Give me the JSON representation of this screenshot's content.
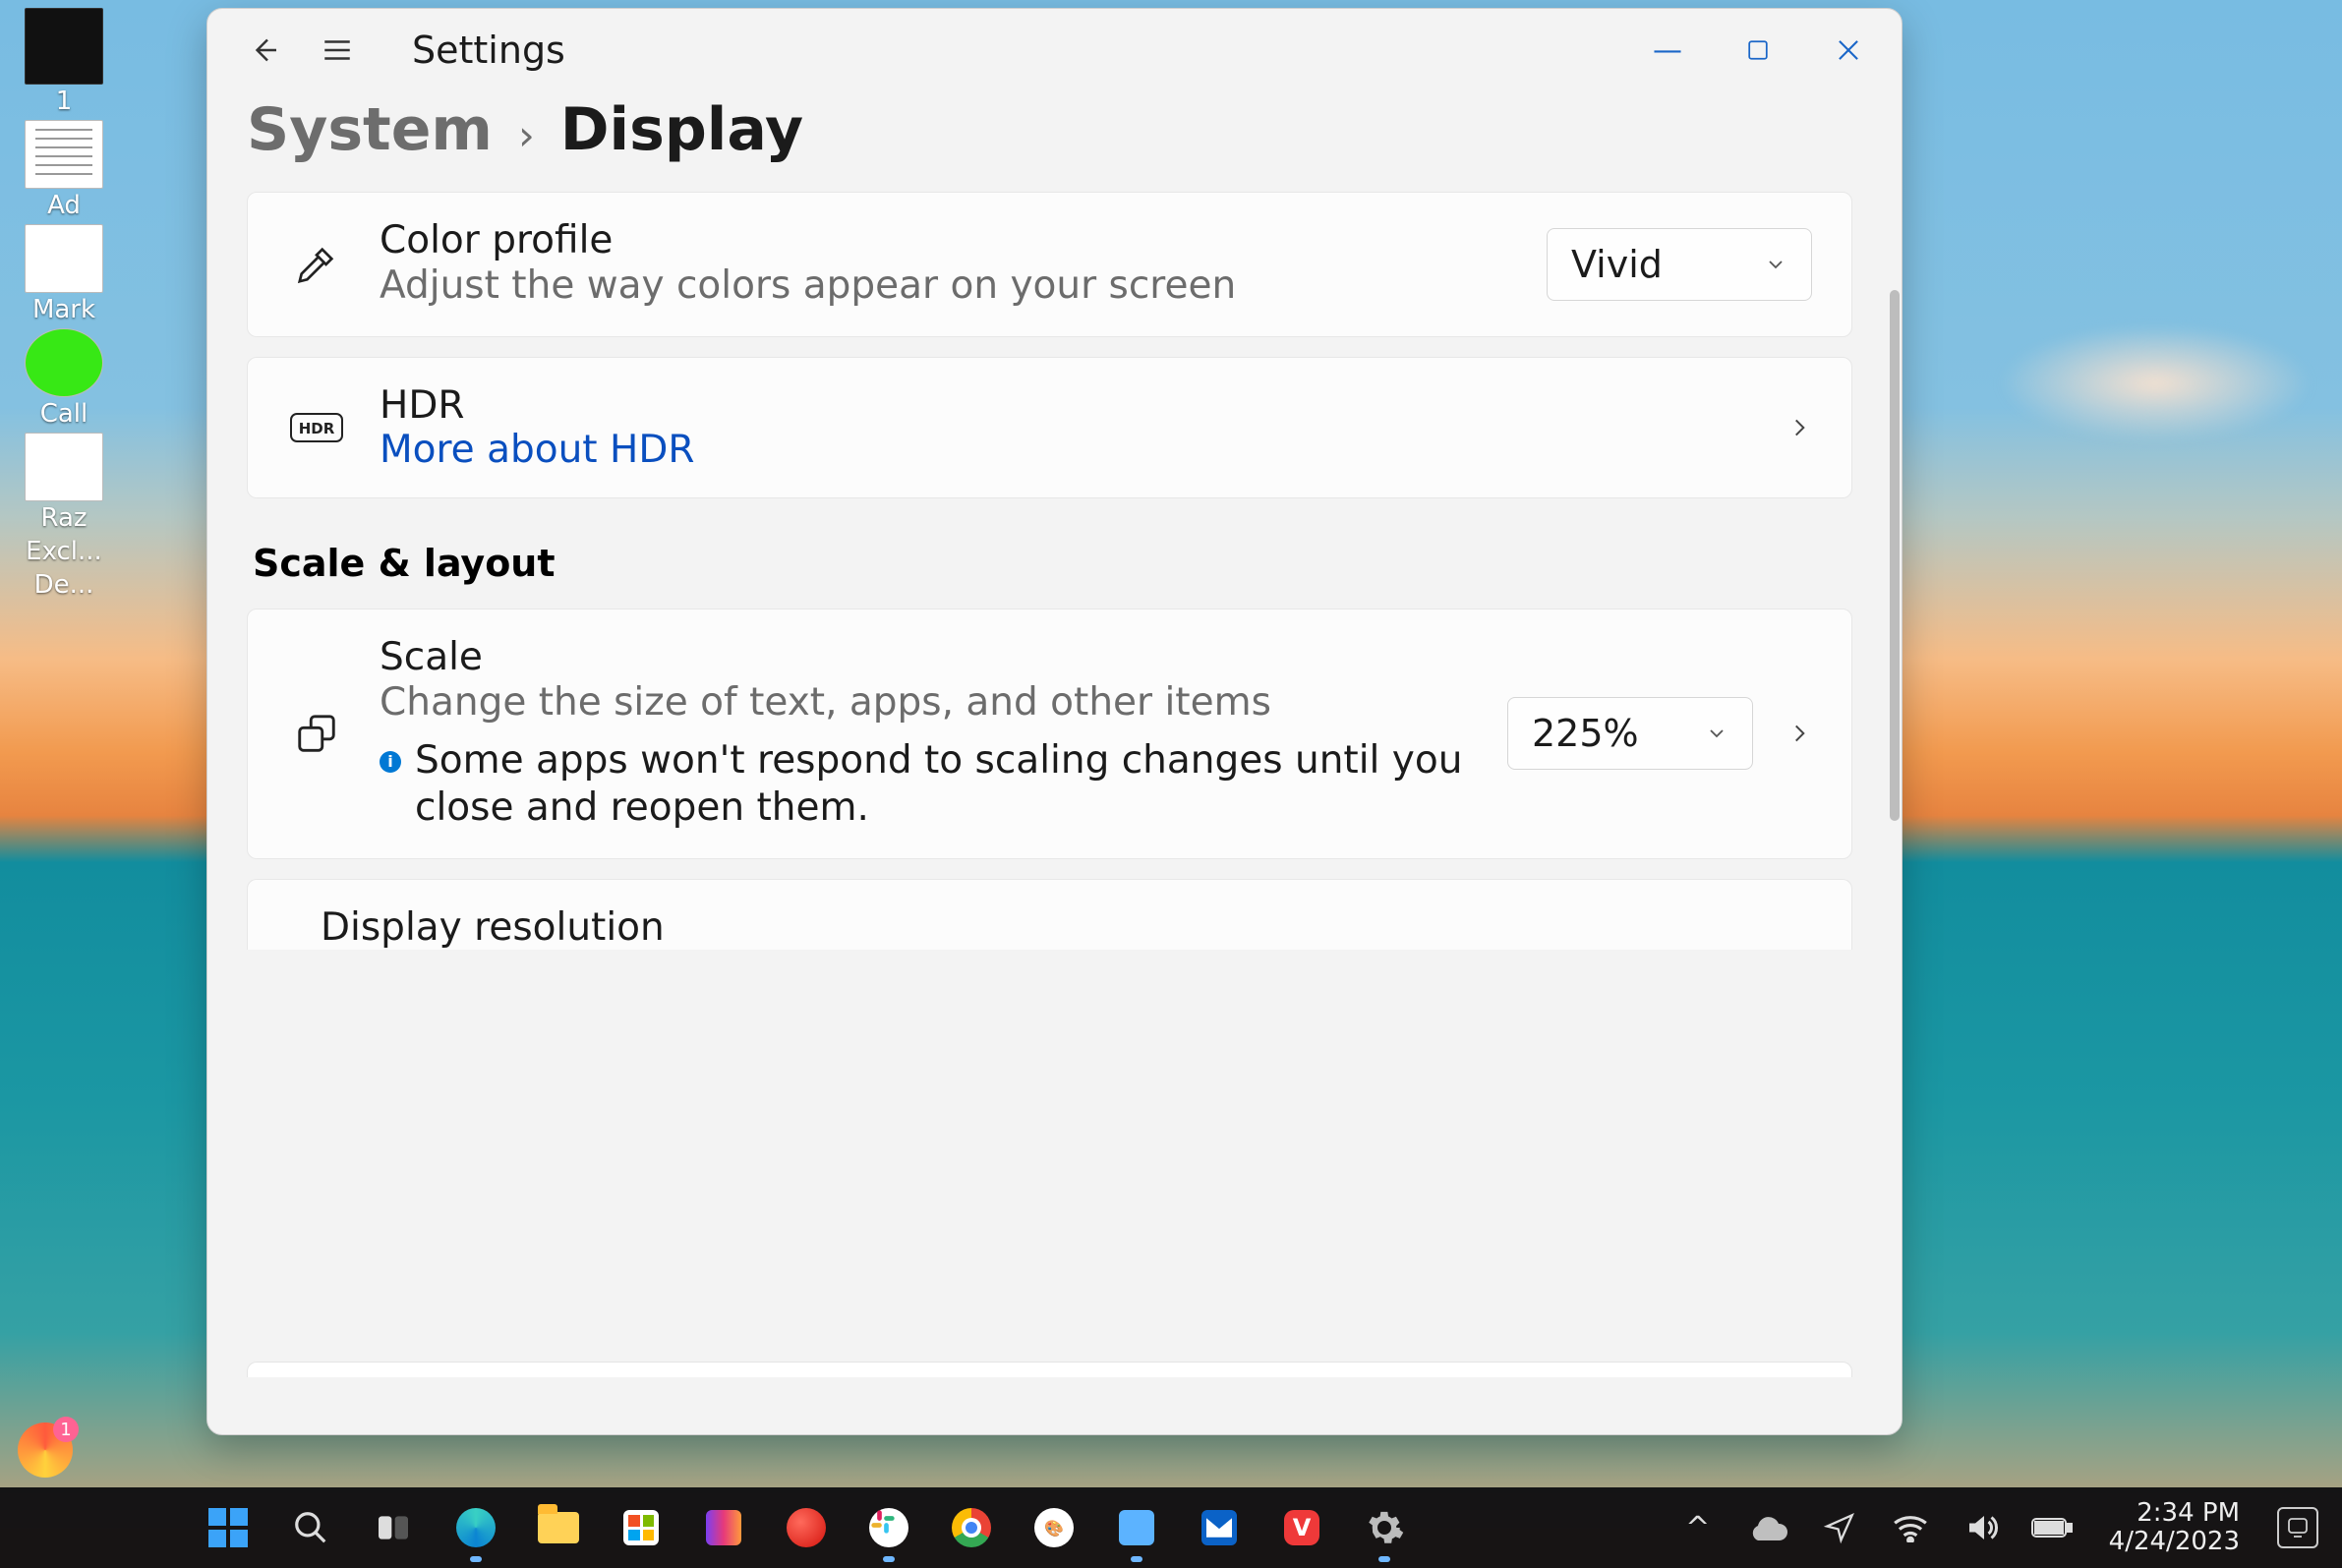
{
  "desktop_icons": [
    {
      "label": "1",
      "kind": "dark"
    },
    {
      "label": "Ad",
      "kind": "page"
    },
    {
      "label": "Mark",
      "kind": "blank"
    },
    {
      "label": "Call",
      "kind": "green"
    },
    {
      "label": "Raz",
      "kind": "blank"
    },
    {
      "label": "Excl...",
      "kind": "none"
    },
    {
      "label": "De...",
      "kind": "none"
    }
  ],
  "window": {
    "app_title": "Settings",
    "breadcrumb": {
      "parent": "System",
      "chevron": "›",
      "current": "Display"
    },
    "color_profile": {
      "title": "Color profile",
      "subtitle": "Adjust the way colors appear on your screen",
      "value": "Vivid"
    },
    "hdr": {
      "title": "HDR",
      "link": "More about HDR"
    },
    "section": "Scale & layout",
    "scale": {
      "title": "Scale",
      "subtitle": "Change the size of text, apps, and other items",
      "info": "Some apps won't respond to scaling changes until you close and reopen them.",
      "value": "225%"
    },
    "next_card_title": "Display resolution"
  },
  "taskbar": {
    "time": "2:34 PM",
    "date": "4/24/2023",
    "tray_caret": "^"
  }
}
